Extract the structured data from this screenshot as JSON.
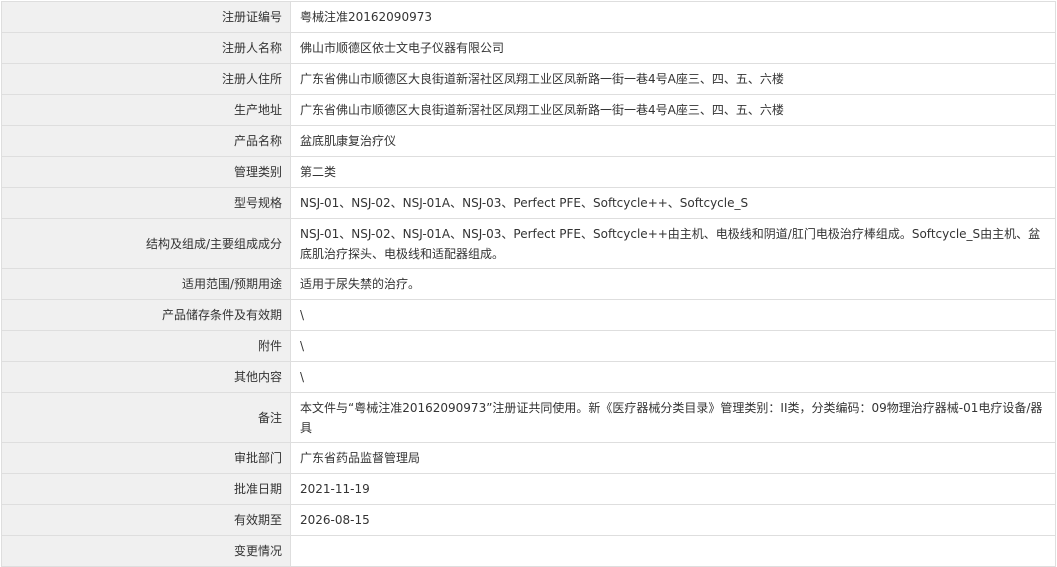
{
  "rows": [
    {
      "label": "注册证编号",
      "value": "粤械注准20162090973"
    },
    {
      "label": "注册人名称",
      "value": "佛山市顺德区依士文电子仪器有限公司"
    },
    {
      "label": "注册人住所",
      "value": "广东省佛山市顺德区大良街道新滘社区凤翔工业区凤新路一街一巷4号A座三、四、五、六楼"
    },
    {
      "label": "生产地址",
      "value": "广东省佛山市顺德区大良街道新滘社区凤翔工业区凤新路一街一巷4号A座三、四、五、六楼"
    },
    {
      "label": "产品名称",
      "value": "盆底肌康复治疗仪"
    },
    {
      "label": "管理类别",
      "value": "第二类"
    },
    {
      "label": "型号规格",
      "value": "NSJ-01、NSJ-02、NSJ-01A、NSJ-03、Perfect PFE、Softcycle++、Softcycle_S"
    },
    {
      "label": "结构及组成/主要组成成分",
      "value": "NSJ-01、NSJ-02、NSJ-01A、NSJ-03、Perfect PFE、Softcycle++由主机、电极线和阴道/肛门电极治疗棒组成。Softcycle_S由主机、盆底肌治疗探头、电极线和适配器组成。"
    },
    {
      "label": "适用范围/预期用途",
      "value": "适用于尿失禁的治疗。"
    },
    {
      "label": "产品储存条件及有效期",
      "value": "\\"
    },
    {
      "label": "附件",
      "value": "\\"
    },
    {
      "label": "其他内容",
      "value": "\\"
    },
    {
      "label": "备注",
      "value": "本文件与“粤械注准20162090973”注册证共同使用。新《医疗器械分类目录》管理类别：II类，分类编码：09物理治疗器械-01电疗设备/器具"
    },
    {
      "label": "审批部门",
      "value": "广东省药品监督管理局"
    },
    {
      "label": "批准日期",
      "value": "2021-11-19"
    },
    {
      "label": "有效期至",
      "value": "2026-08-15"
    },
    {
      "label": "变更情况",
      "value": ""
    }
  ]
}
